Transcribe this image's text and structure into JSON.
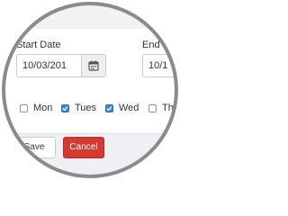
{
  "form": {
    "start_date_label": "Start Date",
    "start_date_value": "10/03/201",
    "end_date_label": "End",
    "end_date_value": "10/1"
  },
  "days": [
    {
      "label": "Mon",
      "checked": false
    },
    {
      "label": "Tues",
      "checked": true
    },
    {
      "label": "Wed",
      "checked": true
    },
    {
      "label": "Th",
      "checked": false
    }
  ],
  "actions": {
    "save_label": "Save",
    "cancel_label": "Cancel"
  },
  "icons": {
    "calendar": "calendar-icon",
    "check": "checkmark-icon"
  },
  "colors": {
    "checkbox_accent": "#3b83e0",
    "cancel_button": "#d33a32",
    "footer_background": "#eef0f3",
    "zoom_ring": "#8b8b8b"
  }
}
